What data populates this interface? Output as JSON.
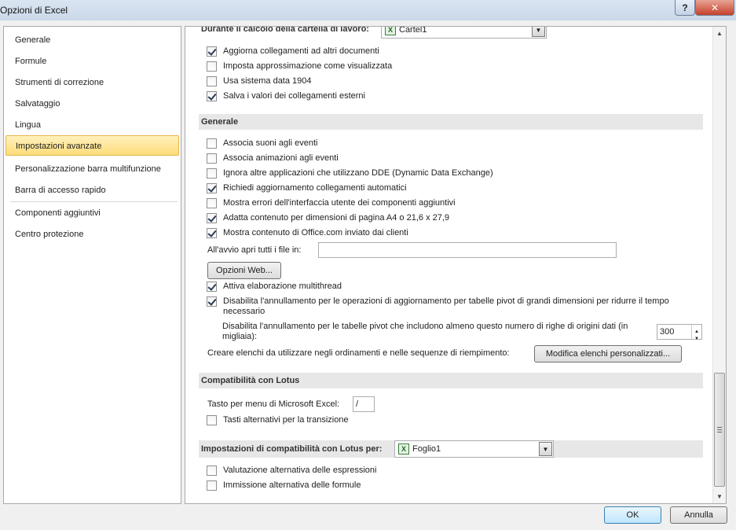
{
  "window": {
    "title": "Opzioni di Excel",
    "help_label": "?",
    "close_label": "✕"
  },
  "sidebar": {
    "items": [
      {
        "label": "Generale"
      },
      {
        "label": "Formule"
      },
      {
        "label": "Strumenti di correzione"
      },
      {
        "label": "Salvataggio"
      },
      {
        "label": "Lingua"
      },
      {
        "label": "Impostazioni avanzate"
      },
      {
        "label": "Personalizzazione barra multifunzione"
      },
      {
        "label": "Barra di accesso rapido"
      },
      {
        "label": "Componenti aggiuntivi"
      },
      {
        "label": "Centro protezione"
      }
    ],
    "active_index": 5
  },
  "calc_section": {
    "header": "Durante il calcolo della cartella di lavoro:",
    "workbook_value": "Cartel1",
    "options": [
      {
        "label": "Aggiorna collegamenti ad altri documenti",
        "checked": true
      },
      {
        "label": "Imposta approssimazione come visualizzata",
        "checked": false
      },
      {
        "label": "Usa sistema data 1904",
        "checked": false
      },
      {
        "label": "Salva i valori dei collegamenti esterni",
        "checked": true
      }
    ]
  },
  "general_section": {
    "header": "Generale",
    "options": [
      {
        "label": "Associa suoni agli eventi",
        "checked": false
      },
      {
        "label": "Associa animazioni agli eventi",
        "checked": false
      },
      {
        "label": "Ignora altre applicazioni che utilizzano DDE (Dynamic Data Exchange)",
        "checked": false
      },
      {
        "label": "Richiedi aggiornamento collegamenti automatici",
        "checked": true
      },
      {
        "label": "Mostra errori dell'interfaccia utente dei componenti aggiuntivi",
        "checked": false
      },
      {
        "label": "Adatta contenuto per dimensioni di pagina A4 o 21,6 x 27,9",
        "checked": true
      },
      {
        "label": "Mostra contenuto di Office.com inviato dai clienti",
        "checked": true
      }
    ],
    "startup_label": "All'avvio apri tutti i file in:",
    "startup_value": "",
    "web_options_button": "Opzioni Web...",
    "multithread": {
      "label": "Attiva elaborazione multithread",
      "checked": true
    },
    "disable_undo": {
      "label": "Disabilita l'annullamento per le operazioni di aggiornamento per tabelle pivot di grandi dimensioni per ridurre il tempo necessario",
      "checked": true
    },
    "undo_rows_label": "Disabilita l'annullamento per le tabelle pivot che includono almeno questo numero di righe di origini dati (in migliaia):",
    "undo_rows_value": "300",
    "custom_lists_label": "Creare elenchi da utilizzare negli ordinamenti e nelle sequenze di riempimento:",
    "custom_lists_button": "Modifica elenchi personalizzati..."
  },
  "lotus_section": {
    "header": "Compatibilità con Lotus",
    "menu_key_label": "Tasto per menu di Microsoft Excel:",
    "menu_key_value": "/",
    "transition_keys": {
      "label": "Tasti alternativi per la transizione",
      "checked": false
    }
  },
  "lotus_compat_section": {
    "header": "Impostazioni di compatibilità con Lotus per:",
    "sheet_value": "Foglio1",
    "options": [
      {
        "label": "Valutazione alternativa delle espressioni",
        "checked": false
      },
      {
        "label": "Immissione alternativa delle formule",
        "checked": false
      }
    ]
  },
  "footer": {
    "ok_label": "OK",
    "cancel_label": "Annulla"
  },
  "scrollbar": {
    "up_icon": "▲",
    "down_icon": "▼"
  },
  "colors": {
    "active_item": "#fddc7a",
    "highlight_ring": "#e11b1b"
  }
}
